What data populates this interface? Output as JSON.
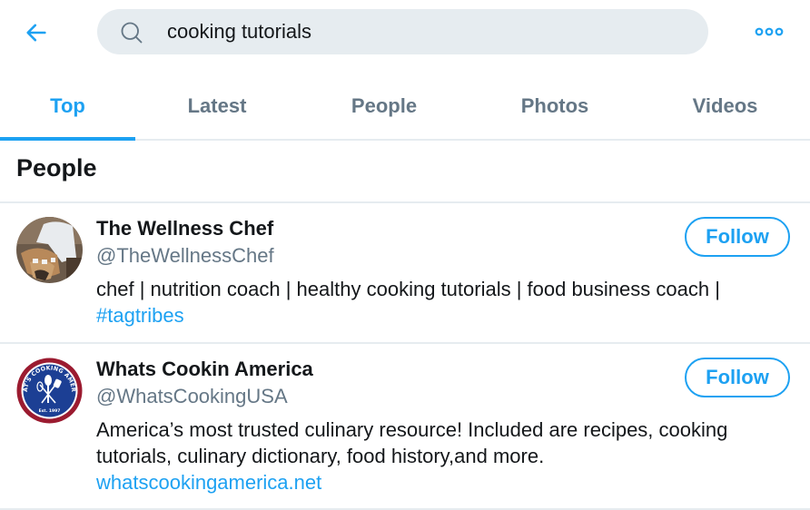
{
  "header": {
    "back_icon": "arrow-left-icon",
    "search_icon": "search-icon",
    "search_value": "cooking tutorials",
    "more_icon": "more-horizontal-icon",
    "accent_color": "#1da1f2"
  },
  "tabs": [
    {
      "label": "Top",
      "active": true
    },
    {
      "label": "Latest",
      "active": false
    },
    {
      "label": "People",
      "active": false
    },
    {
      "label": "Photos",
      "active": false
    },
    {
      "label": "Videos",
      "active": false
    }
  ],
  "section": {
    "title": "People"
  },
  "users": [
    {
      "name": "The Wellness Chef",
      "handle": "@TheWellnessChef",
      "bio": "chef | nutrition coach | healthy cooking tutorials | food business coach |",
      "bio_link": "#tagtribes",
      "follow_label": "Follow",
      "avatar": "chef-photo-avatar"
    },
    {
      "name": "Whats Cookin America",
      "handle": "@WhatsCookingUSA",
      "bio": "America’s most trusted culinary resource! Included are recipes, cooking tutorials, culinary dictionary, food history,and more.",
      "bio_link": "whatscookingamerica.net",
      "follow_label": "Follow",
      "avatar": "whats-cooking-america-logo",
      "avatar_text_top": "WHAT'S COOKING AMERICA",
      "avatar_text_bottom": "Est. 1997"
    }
  ]
}
